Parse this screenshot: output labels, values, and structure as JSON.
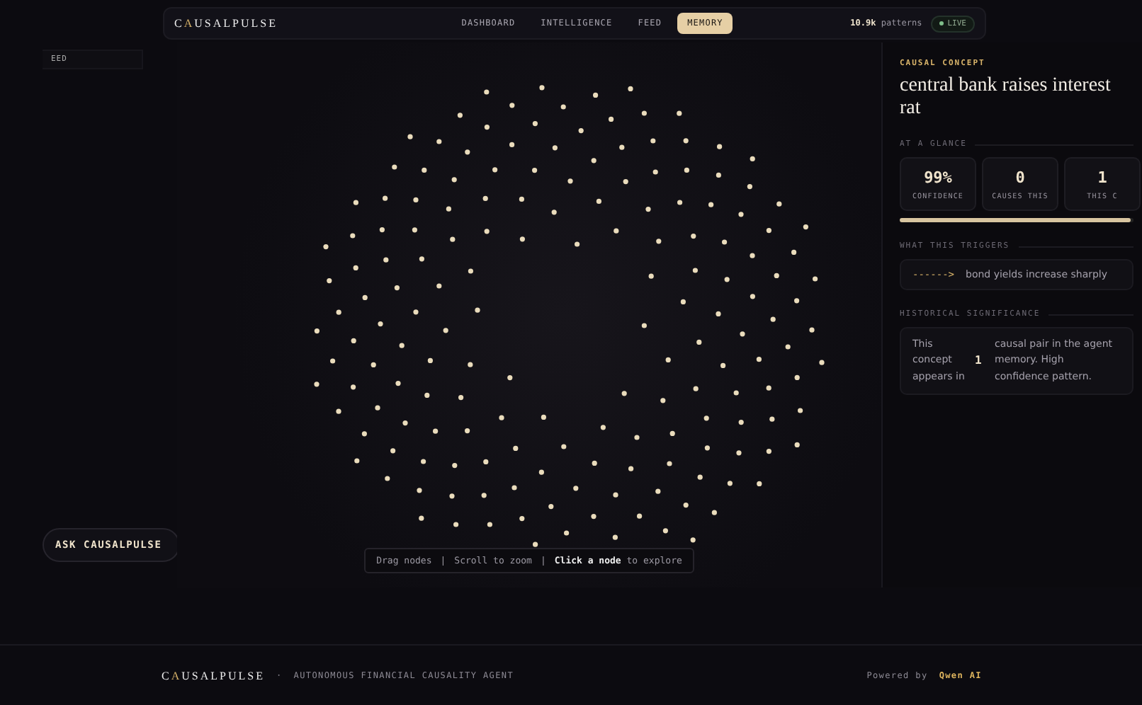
{
  "header": {
    "logo": {
      "first": "C",
      "accent": "A",
      "rest": "USALPULSE"
    },
    "tabs": [
      {
        "label": "DASHBOARD",
        "selected": false
      },
      {
        "label": "INTELLIGENCE",
        "selected": false
      },
      {
        "label": "FEED",
        "selected": false
      },
      {
        "label": "MEMORY",
        "selected": true
      }
    ],
    "patterns": "**10.9k** patterns",
    "live": {
      "label": "LIVE",
      "on": true
    }
  },
  "side": {
    "cut_label": "EED",
    "ask_button": "ASK CAUSALPULSE"
  },
  "graph": {
    "hints": [
      "Drag nodes",
      "Scroll to zoom",
      "**Click a node** to explore"
    ],
    "separator": "|"
  },
  "panel": {
    "eyebrow": "CAUSAL CONCEPT",
    "title": "central bank raises interest rat",
    "glance_heading": "AT A GLANCE",
    "stats": [
      {
        "value": "99%",
        "label": "CONFIDENCE"
      },
      {
        "value": "0",
        "label": "CAUSES THIS"
      },
      {
        "value": "1",
        "label": "THIS C"
      }
    ],
    "confidence": {
      "level": 0.99
    },
    "triggers_heading": "WHAT THIS TRIGGERS",
    "triggers": [
      {
        "arrow": "------>",
        "text": "bond yields increase sharply"
      }
    ],
    "history_heading": "HISTORICAL SIGNIFICANCE",
    "history": {
      "lead": "This concept appears in",
      "count": "1",
      "tail": "causal pair in the agent memory. High confidence pattern."
    }
  },
  "footer": {
    "logo": {
      "first": "C",
      "accent": "A",
      "rest": "USALPULSE"
    },
    "separator": "·",
    "tagline": "AUTONOMOUS FINANCIAL CAUSALITY AGENT",
    "powered": "Powered by",
    "brand": "Qwen AI"
  }
}
